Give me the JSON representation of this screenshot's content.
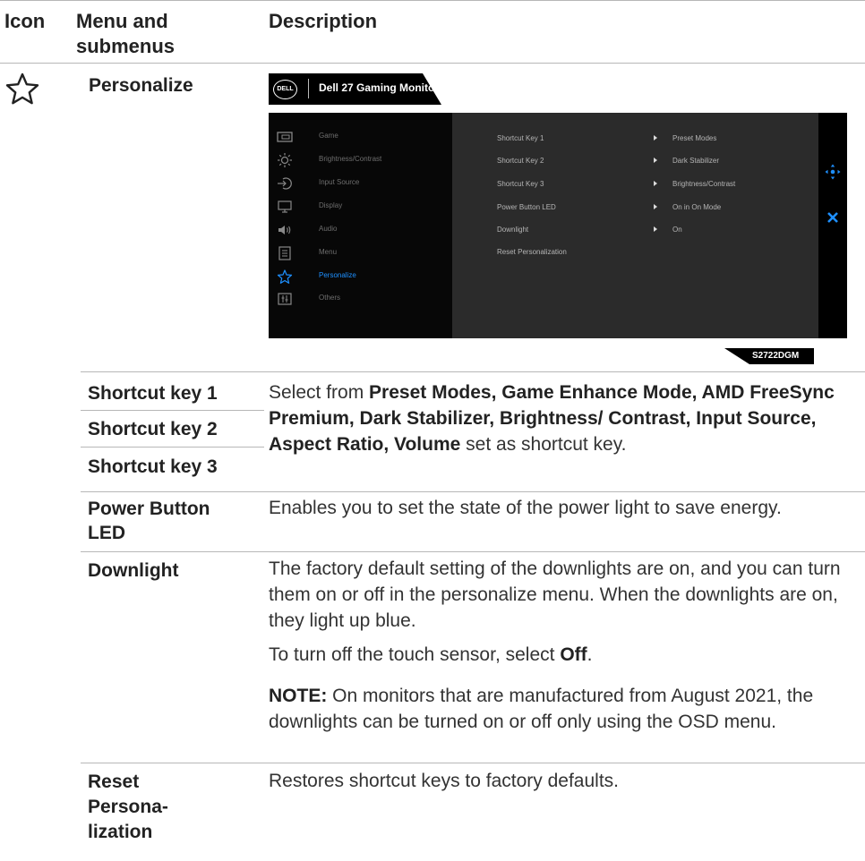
{
  "header": {
    "col_icon": "Icon",
    "col_menu_line1": "Menu and",
    "col_menu_line2": "submenus",
    "col_desc": "Description"
  },
  "section": {
    "icon": "star-outline-icon",
    "title": "Personalize"
  },
  "osd": {
    "brand_logo": "DELL",
    "title": "Dell 27 Gaming Monitor",
    "model": "S2722DGM",
    "accent_color": "#1e90ff",
    "nav_items": [
      {
        "icon": "game-icon",
        "label": "Game"
      },
      {
        "icon": "brightness-icon",
        "label": "Brightness/Contrast"
      },
      {
        "icon": "input-source-icon",
        "label": "Input Source"
      },
      {
        "icon": "display-icon",
        "label": "Display"
      },
      {
        "icon": "audio-icon",
        "label": "Audio"
      },
      {
        "icon": "menu-icon",
        "label": "Menu"
      },
      {
        "icon": "star-icon",
        "label": "Personalize",
        "active": true
      },
      {
        "icon": "others-icon",
        "label": "Others"
      }
    ],
    "options": [
      {
        "label": "Shortcut Key 1",
        "value": "Preset Modes"
      },
      {
        "label": "Shortcut Key 2",
        "value": "Dark Stabilizer"
      },
      {
        "label": "Shortcut Key 3",
        "value": "Brightness/Contrast"
      },
      {
        "label": "Power Button LED",
        "value": "On in On Mode"
      },
      {
        "label": "Downlight",
        "value": "On"
      },
      {
        "label": "Reset Personalization",
        "value": ""
      }
    ],
    "side_icons": [
      "move-joystick-icon",
      "close-icon"
    ]
  },
  "rows": {
    "shortcut1": "Shortcut key 1",
    "shortcut2": "Shortcut key 2",
    "shortcut3": "Shortcut key 3",
    "shortcut_desc_pre": "Select from ",
    "shortcut_desc_bold": "Preset Modes, Game Enhance Mode, AMD FreeSync Premium, Dark Stabilizer, Brightness/ Contrast, Input Source, Aspect Ratio, Volume",
    "shortcut_desc_post": " set as shortcut key.",
    "power_label_1": "Power Button",
    "power_label_2": "LED",
    "power_desc": "Enables you to set the state of the power light to save energy.",
    "downlight_label": "Downlight",
    "downlight_desc1": "The factory default setting of the downlights are on, and you can turn them on or off in the personalize menu. When the downlights are on, they light up blue.",
    "downlight_desc2_pre": "To turn off the touch sensor, select ",
    "downlight_desc2_bold": "Off",
    "downlight_desc2_post": ".",
    "note_bold": "NOTE:",
    "note_text": " On monitors that are manufactured from August 2021, the downlights can be turned on or off only using the OSD menu.",
    "reset_label_1": "Reset",
    "reset_label_2": "Persona-",
    "reset_label_3": "lization",
    "reset_desc": "Restores shortcut keys to factory defaults."
  }
}
